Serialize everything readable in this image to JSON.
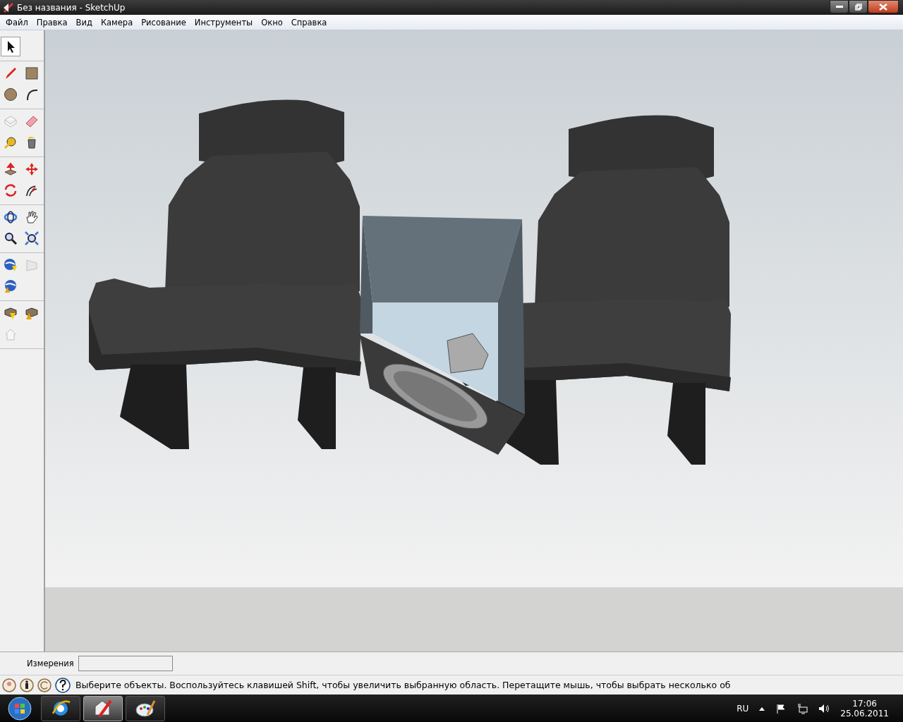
{
  "window": {
    "title": "Без названия - SketchUp"
  },
  "menu": [
    "Файл",
    "Правка",
    "Вид",
    "Камера",
    "Рисование",
    "Инструменты",
    "Окно",
    "Справка"
  ],
  "tool_groups": [
    [
      {
        "kind": "select",
        "selected": true,
        "disabled": false
      }
    ],
    [
      {
        "kind": "pencil",
        "selected": false,
        "disabled": false
      },
      {
        "kind": "rectangle",
        "selected": false,
        "disabled": false
      },
      {
        "kind": "circle",
        "selected": false,
        "disabled": false
      },
      {
        "kind": "arc",
        "selected": false,
        "disabled": false
      }
    ],
    [
      {
        "kind": "component",
        "selected": false,
        "disabled": true
      },
      {
        "kind": "eraser",
        "selected": false,
        "disabled": false
      },
      {
        "kind": "tape",
        "selected": false,
        "disabled": false
      },
      {
        "kind": "bucket",
        "selected": false,
        "disabled": false
      }
    ],
    [
      {
        "kind": "pushpull",
        "selected": false,
        "disabled": false
      },
      {
        "kind": "move",
        "selected": false,
        "disabled": false
      },
      {
        "kind": "rotate",
        "selected": false,
        "disabled": false
      },
      {
        "kind": "offset",
        "selected": false,
        "disabled": false
      }
    ],
    [
      {
        "kind": "orbit",
        "selected": false,
        "disabled": false
      },
      {
        "kind": "pan",
        "selected": false,
        "disabled": false
      },
      {
        "kind": "zoom",
        "selected": false,
        "disabled": false
      },
      {
        "kind": "extents",
        "selected": false,
        "disabled": false
      }
    ],
    [
      {
        "kind": "globe-down",
        "selected": false,
        "disabled": false
      },
      {
        "kind": "photo",
        "selected": false,
        "disabled": true
      },
      {
        "kind": "globe-up",
        "selected": false,
        "disabled": false
      }
    ],
    [
      {
        "kind": "box-down",
        "selected": false,
        "disabled": false
      },
      {
        "kind": "box-up",
        "selected": false,
        "disabled": false
      },
      {
        "kind": "house",
        "selected": false,
        "disabled": true
      }
    ]
  ],
  "measurements": {
    "label": "Измерения"
  },
  "status_bar": {
    "text": "Выберите объекты. Воспользуйтесь клавишей Shift, чтобы увеличить выбранную область. Перетащите мышь, чтобы выбрать несколько об"
  },
  "taskbar": {
    "apps": [
      {
        "kind": "ie",
        "selected": false
      },
      {
        "kind": "sketchup",
        "selected": true
      },
      {
        "kind": "paint",
        "selected": false
      }
    ],
    "tray": {
      "language": "RU",
      "time": "17:06",
      "date": "25.06.2011"
    }
  }
}
